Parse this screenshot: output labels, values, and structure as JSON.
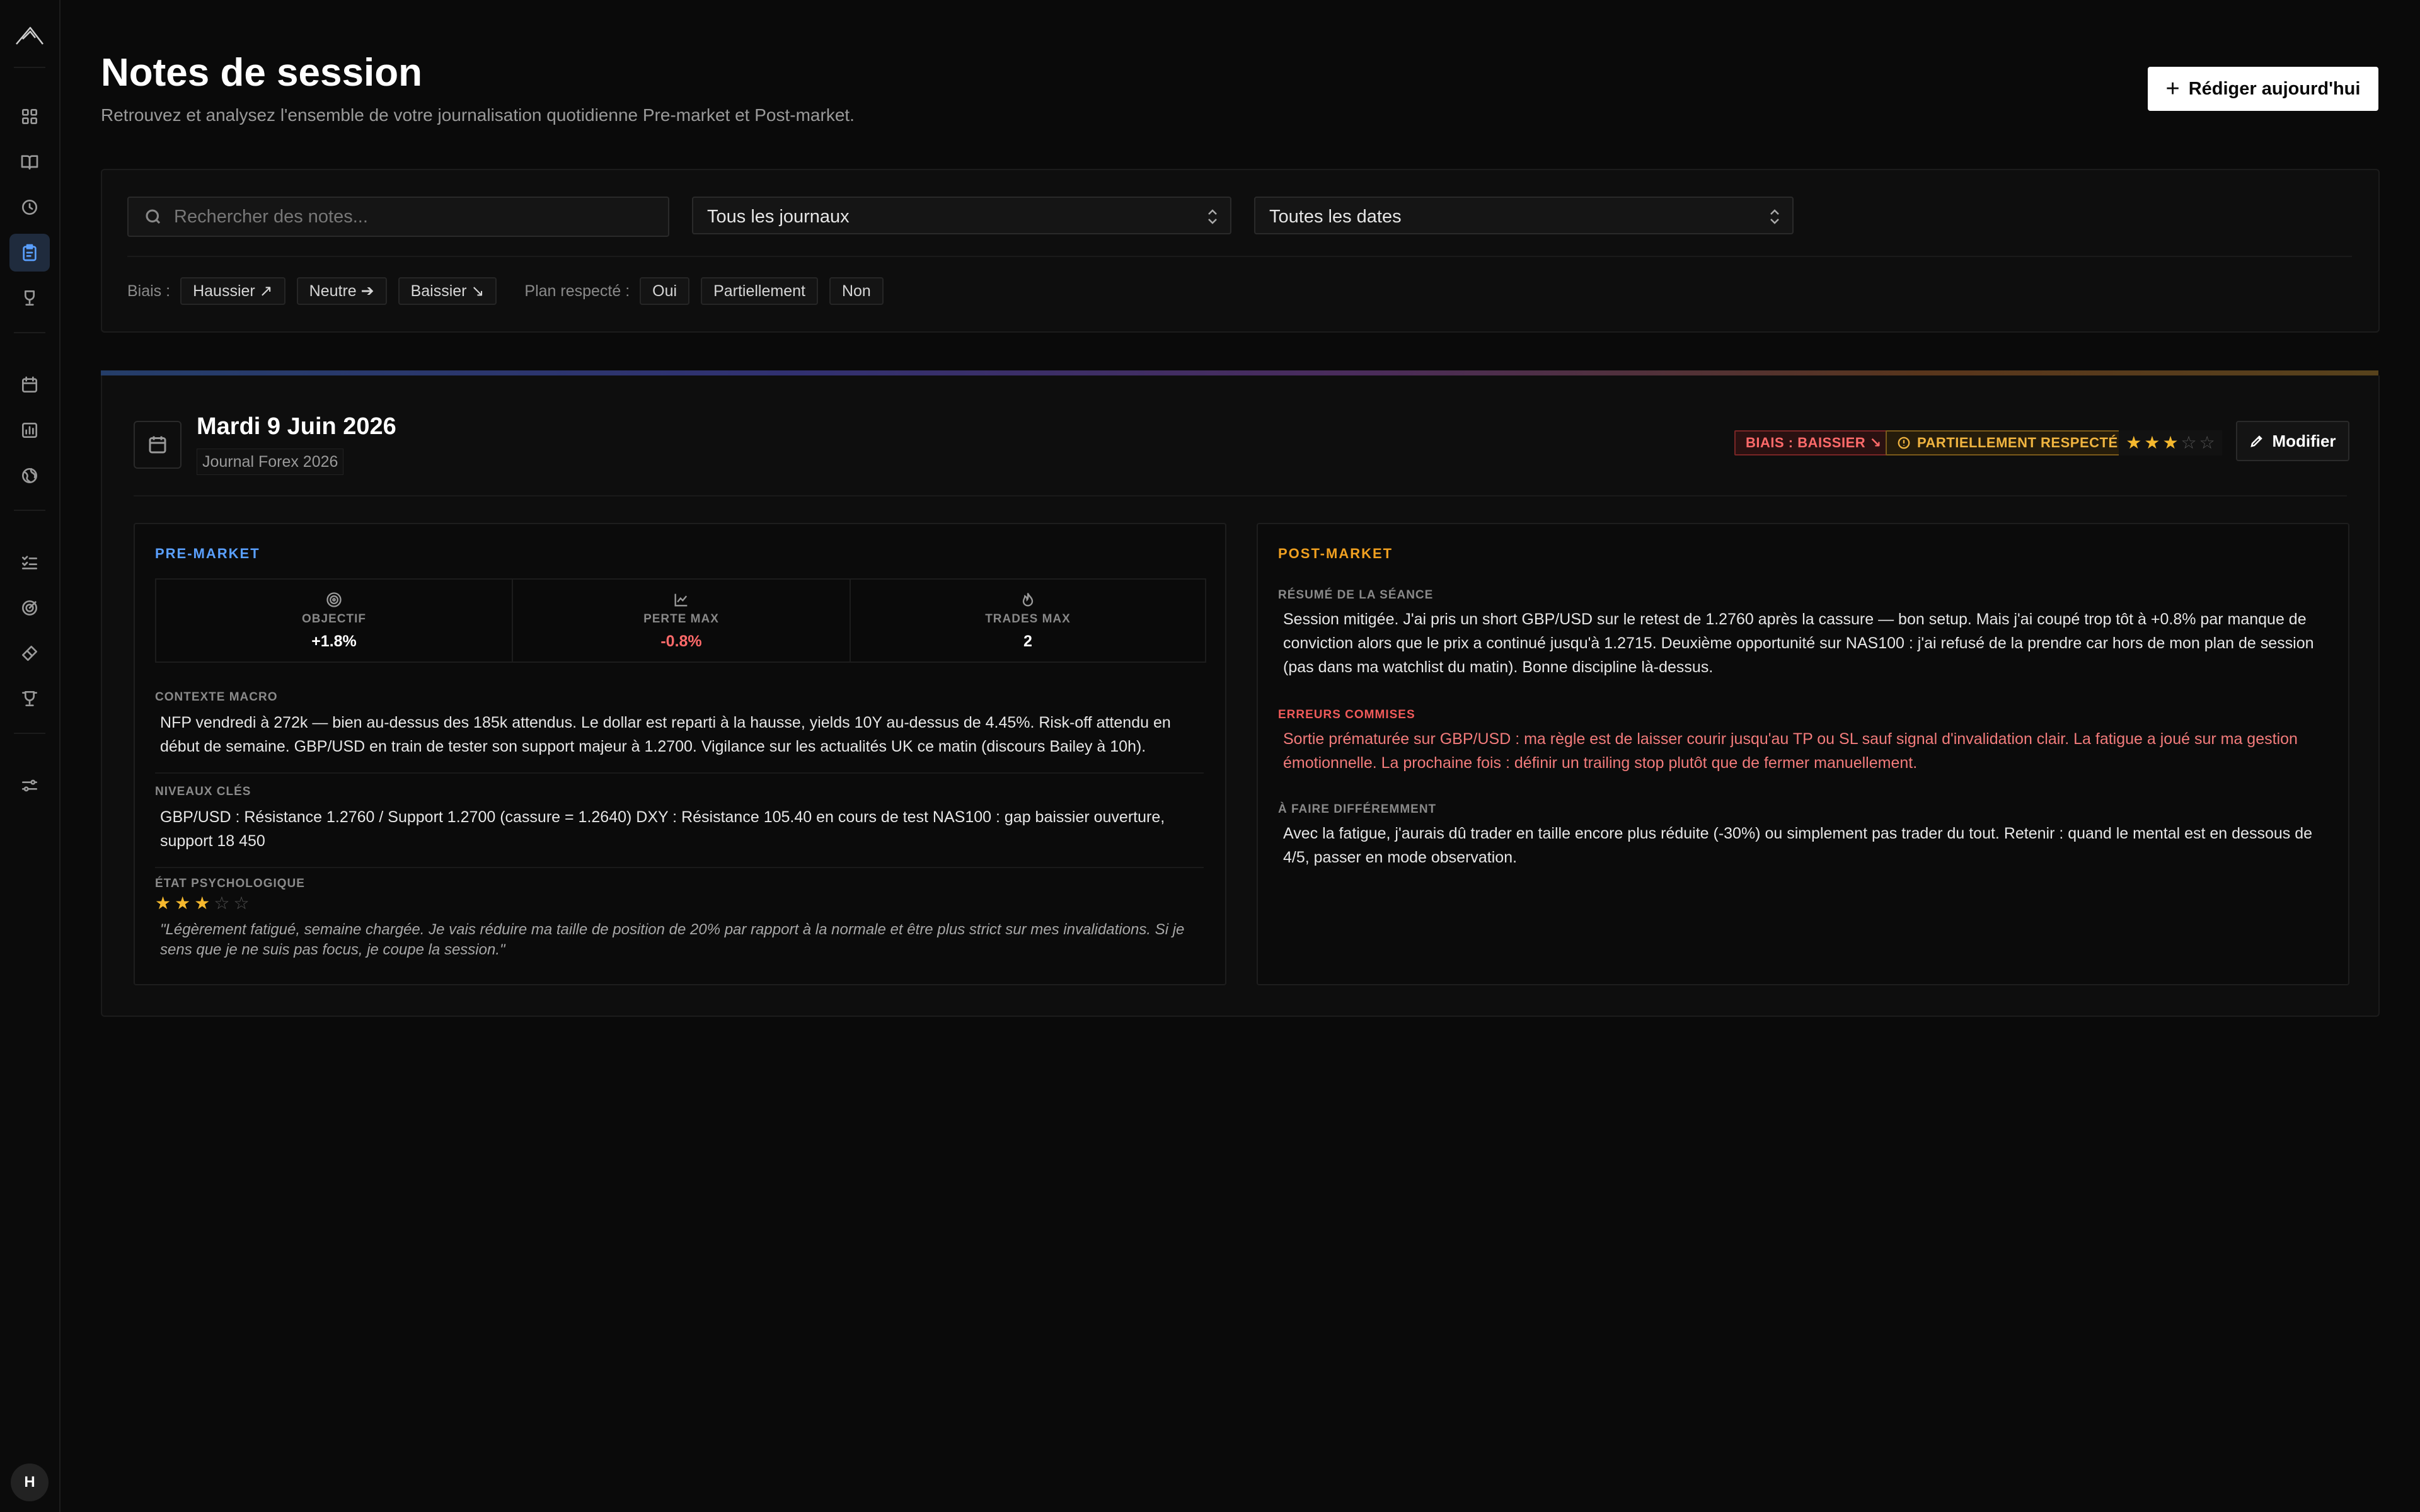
{
  "sidebar": {
    "icons": [
      "logo-icon",
      "dashboard-icon",
      "book-icon",
      "clock-icon",
      "notes-icon",
      "trophy-icon",
      "calendar-icon",
      "chart-icon",
      "globe-icon",
      "checklist-icon",
      "target-icon",
      "ticket-icon",
      "award-icon",
      "sliders-icon"
    ],
    "active": "notes-icon",
    "avatar": "H"
  },
  "header": {
    "title": "Notes de session",
    "subtitle": "Retrouvez et analysez l'ensemble de votre journalisation quotidienne Pre-market et Post-market.",
    "new_button": "Rédiger aujourd'hui"
  },
  "filters": {
    "search_placeholder": "Rechercher des notes...",
    "journal_select": "Tous les journaux",
    "date_select": "Toutes les dates",
    "bias_label": "Biais :",
    "bias_options": [
      "Haussier ↗",
      "Neutre ➔",
      "Baissier ↘"
    ],
    "plan_label": "Plan respecté :",
    "plan_options": [
      "Oui",
      "Partiellement",
      "Non"
    ]
  },
  "note": {
    "date": "Mardi 9 Juin 2026",
    "journal": "Journal Forex 2026",
    "bias_badge": "BIAIS : BAISSIER ↘",
    "plan_badge": "PARTIELLEMENT RESPECTÉ",
    "rating": 3,
    "rating_max": 5,
    "edit_button": "Modifier",
    "pre_market": {
      "title": "PRE-MARKET",
      "stats": [
        {
          "label": "OBJECTIF",
          "value": "+1.8%"
        },
        {
          "label": "PERTE MAX",
          "value": "-0.8%"
        },
        {
          "label": "TRADES MAX",
          "value": "2"
        }
      ],
      "macro_label": "CONTEXTE MACRO",
      "macro_text": "NFP vendredi à 272k — bien au-dessus des 185k attendus. Le dollar est reparti à la hausse, yields 10Y au-dessus de 4.45%. Risk-off attendu en début de semaine. GBP/USD en train de tester son support majeur à 1.2700. Vigilance sur les actualités UK ce matin (discours Bailey à 10h).",
      "levels_label": "NIVEAUX CLÉS",
      "levels_text": "GBP/USD : Résistance 1.2760 / Support 1.2700 (cassure = 1.2640) DXY : Résistance 105.40 en cours de test NAS100 : gap baissier ouverture, support 18 450",
      "psych_label": "ÉTAT PSYCHOLOGIQUE",
      "psych_rating": 3,
      "psych_quote": "\"Légèrement fatigué, semaine chargée. Je vais réduire ma taille de position de 20% par rapport à la normale et être plus strict sur mes invalidations. Si je sens que je ne suis pas focus, je coupe la session.\""
    },
    "post_market": {
      "title": "POST-MARKET",
      "summary_label": "RÉSUMÉ DE LA SÉANCE",
      "summary_text": "Session mitigée. J'ai pris un short GBP/USD sur le retest de 1.2760 après la cassure — bon setup. Mais j'ai coupé trop tôt à +0.8% par manque de conviction alors que le prix a continué jusqu'à 1.2715. Deuxième opportunité sur NAS100 : j'ai refusé de la prendre car hors de mon plan de session (pas dans ma watchlist du matin). Bonne discipline là-dessus.",
      "errors_label": "ERREURS COMMISES",
      "errors_text": "Sortie prématurée sur GBP/USD : ma règle est de laisser courir jusqu'au TP ou SL sauf signal d'invalidation clair. La fatigue a joué sur ma gestion émotionnelle. La prochaine fois : définir un trailing stop plutôt que de fermer manuellement.",
      "diff_label": "À FAIRE DIFFÉREMMENT",
      "diff_text": "Avec la fatigue, j'aurais dû trader en taille encore plus réduite (-30%) ou simplement pas trader du tout. Retenir : quand le mental est en dessous de 4/5, passer en mode observation."
    }
  },
  "colors": {
    "accent_blue": "#5aa0ff",
    "accent_orange": "#f0a020",
    "negative": "#ff6a6a",
    "star": "#f5b82e"
  }
}
